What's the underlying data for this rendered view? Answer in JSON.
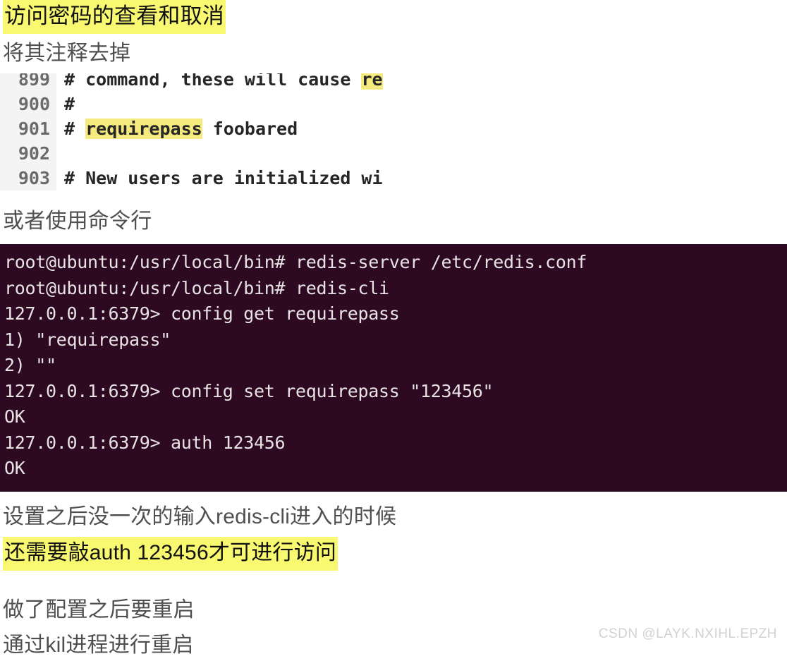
{
  "document": {
    "heading": "访问密码的查看和取消",
    "subheading": "将其注释去掉",
    "code_caption": "或者使用命令行",
    "note_line_1": "设置之后没一次的输入redis-cli进入的时候",
    "note_line_2": "还需要敲auth 123456才可进行访问",
    "closing_line_1": "做了配置之后要重启",
    "closing_line_2": "通过kil进程进行重启",
    "watermark": "CSDN @LAYK.NXIHL.EPZH"
  },
  "colors": {
    "highlight_yellow": "#f9f871",
    "code_highlight_yellow": "#f5ea7e",
    "terminal_bg": "#2d0922",
    "terminal_fg": "#e8e3e3",
    "gutter_bg": "#f4f4f4",
    "body_text": "#4f4f4f"
  },
  "code_block": {
    "language": "redis.conf",
    "lines": [
      {
        "number": "899",
        "parts": [
          {
            "text": "# command, these will cause ",
            "highlight": false
          },
          {
            "text": "re",
            "highlight": true
          }
        ]
      },
      {
        "number": "900",
        "parts": [
          {
            "text": "#",
            "highlight": false
          }
        ]
      },
      {
        "number": "901",
        "parts": [
          {
            "text": "# ",
            "highlight": false
          },
          {
            "text": "requirepass",
            "highlight": true
          },
          {
            "text": " foobared",
            "highlight": false
          }
        ]
      },
      {
        "number": "902",
        "parts": [
          {
            "text": "",
            "highlight": false
          }
        ]
      },
      {
        "number": "903",
        "parts": [
          {
            "text": "# New users are initialized wi",
            "highlight": false
          }
        ]
      }
    ]
  },
  "terminal": {
    "lines": [
      "root@ubuntu:/usr/local/bin# redis-server /etc/redis.conf",
      "root@ubuntu:/usr/local/bin# redis-cli",
      "127.0.0.1:6379> config get requirepass",
      "1) \"requirepass\"",
      "2) \"\"",
      "127.0.0.1:6379> config set requirepass \"123456\"",
      "OK",
      "127.0.0.1:6379> auth 123456",
      "OK"
    ]
  }
}
